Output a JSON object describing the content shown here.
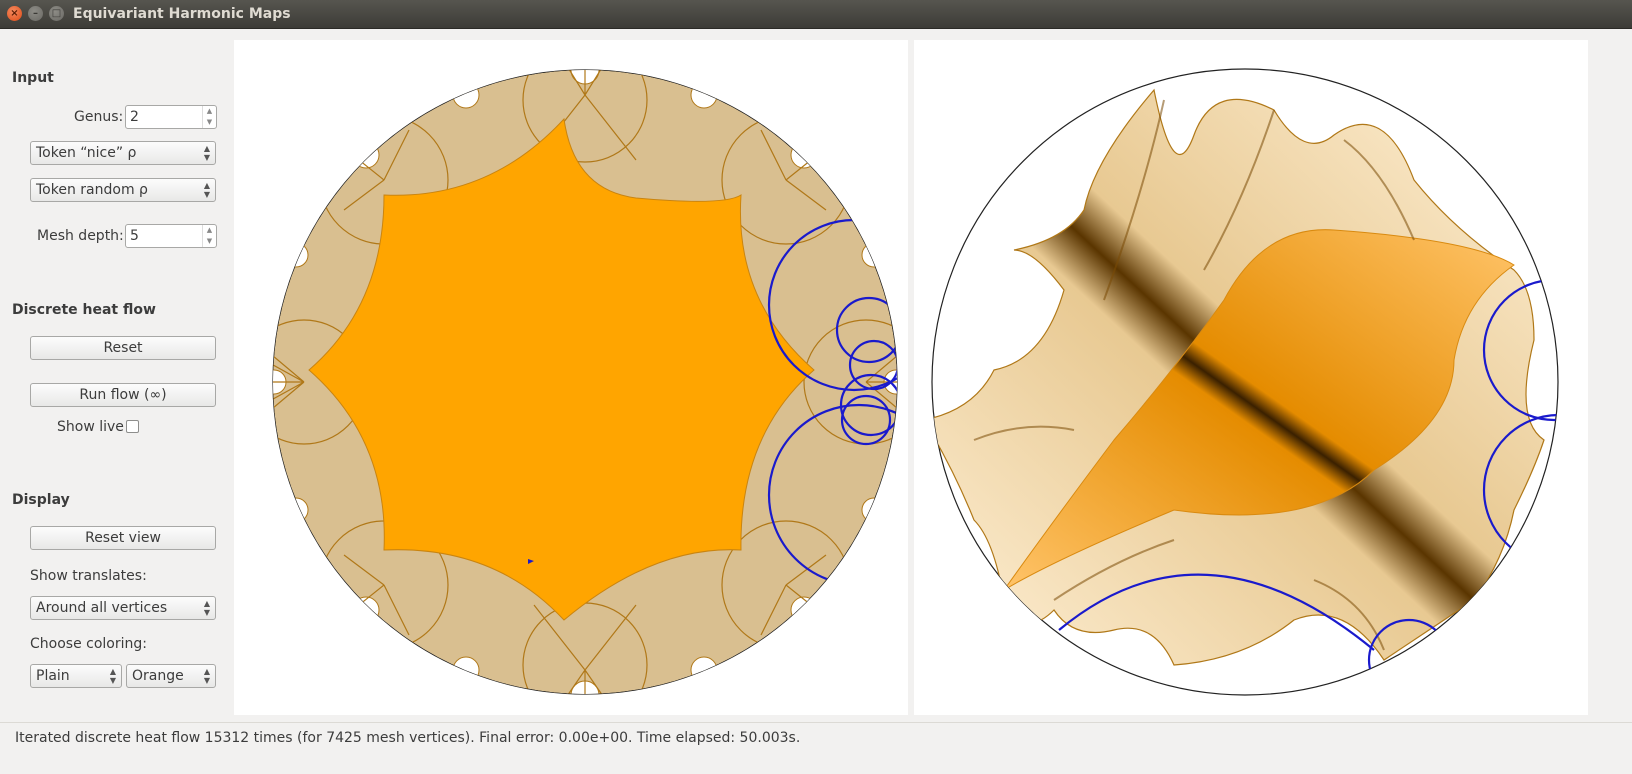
{
  "window": {
    "title": "Equivariant Harmonic Maps"
  },
  "input": {
    "section_title": "Input",
    "genus_label": "Genus:",
    "genus_value": "2",
    "rho1_select": "Token “nice” ρ",
    "rho2_select": "Token random ρ",
    "mesh_depth_label": "Mesh depth:",
    "mesh_depth_value": "5"
  },
  "heat_flow": {
    "section_title": "Discrete heat flow",
    "reset_label": "Reset",
    "run_label": "Run flow (∞)",
    "show_live_label": "Show live",
    "show_live_checked": false
  },
  "display": {
    "section_title": "Display",
    "reset_view_label": "Reset view",
    "show_translates_label": "Show translates:",
    "translates_select": "Around all vertices",
    "coloring_label": "Choose coloring:",
    "coloring_mode": "Plain",
    "coloring_color": "Orange"
  },
  "status": {
    "text": "Iterated discrete heat flow 15312 times (for 7425 mesh vertices). Final error: 0.00e+00. Time elapsed: 50.003s."
  },
  "colors": {
    "fundamental_domain": "#ffa500",
    "translates": "#d9bf90",
    "edges": "#b07818",
    "geodesics": "#1a1acc"
  }
}
